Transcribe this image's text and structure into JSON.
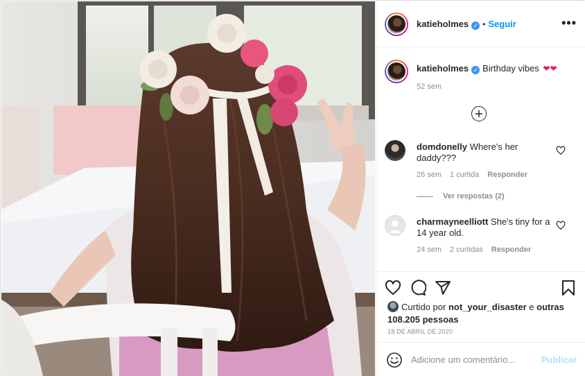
{
  "post": {
    "author": "katieholmes",
    "follow_label": "Seguir",
    "more_label": "•••",
    "dot": "•"
  },
  "caption": {
    "username": "katieholmes",
    "text": "Birthday vibes",
    "emojis": "❤❤",
    "time": "52 sem"
  },
  "comments": [
    {
      "username": "domdonelly",
      "text": "Where's her daddy???",
      "time": "26 sem",
      "likes": "1 curtida",
      "reply_label": "Responder",
      "view_replies": "Ver respostas (2)"
    },
    {
      "username": "charmayneelliott",
      "text": "She's tiny for a 14 year old.",
      "time": "24 sem",
      "likes": "2 curtidas",
      "reply_label": "Responder"
    }
  ],
  "likes": {
    "prefix": "Curtido por",
    "user": "not_your_disaster",
    "conjunction": "e",
    "others": "outras 108.205 pessoas"
  },
  "date": "18 DE ABRIL DE 2020",
  "add_comment": {
    "placeholder": "Adicione um comentário...",
    "publish_label": "Publicar"
  },
  "icons": {
    "verified": "verified-badge-icon",
    "like": "heart-outline-icon",
    "comment": "comment-bubble-icon",
    "share": "paper-plane-icon",
    "save": "bookmark-icon",
    "emoji": "smiley-icon",
    "load_more": "plus-circle-icon"
  },
  "colors": {
    "accent": "#0095f6",
    "verified": "#3897f0",
    "muted": "#8e8e8e",
    "publish_disabled": "#b2dffc"
  }
}
